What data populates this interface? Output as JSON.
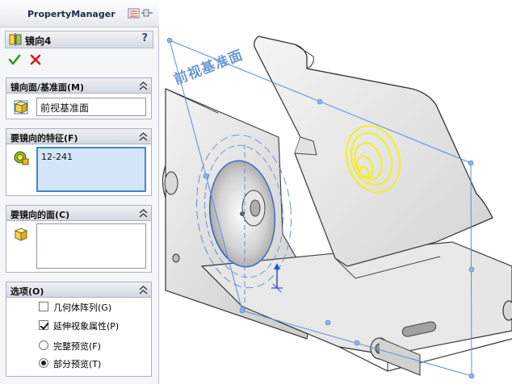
{
  "pm": {
    "title": "PropertyManager"
  },
  "feature": {
    "name": "镜向4",
    "help": "?"
  },
  "groups": {
    "mirror_plane": {
      "title": "镜向面/基准面(M)",
      "value": "前视基准面"
    },
    "features": {
      "title": "要镜向的特征(F)",
      "items": [
        "12-241"
      ]
    },
    "faces": {
      "title": "要镜向的面(C)",
      "items": []
    },
    "options": {
      "title": "选项(O)",
      "geometry_pattern": {
        "label": "几何体阵列(G)",
        "checked": false
      },
      "propagate": {
        "label": "延伸视象属性(P)",
        "checked": true
      },
      "full_preview": {
        "label": "完整预览(F)",
        "selected": false
      },
      "partial_preview": {
        "label": "部分预览(T)",
        "selected": true
      }
    }
  },
  "viewport": {
    "plane_label": "前视基准面"
  },
  "colors": {
    "plane_blue": "#5b8fd6",
    "highlight_yellow": "#f2ee17",
    "axis_blue": "#2e4fd6"
  },
  "icons": {
    "ok": "check-icon",
    "cancel": "cross-icon",
    "feature": "mirror-feature-icon",
    "plane": "plane-cube-icon",
    "features": "feature-select-icon",
    "faces": "face-cube-icon"
  }
}
